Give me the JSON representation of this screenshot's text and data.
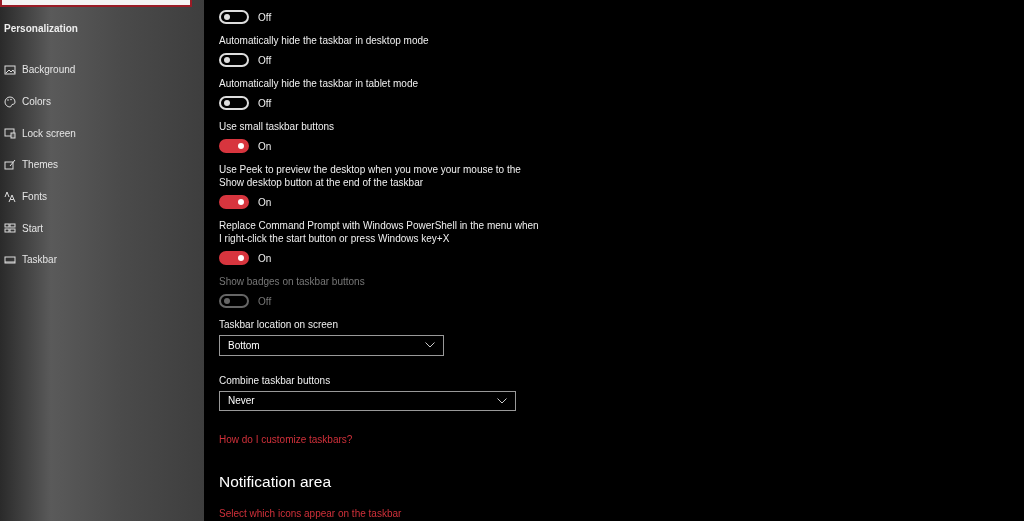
{
  "sidebar": {
    "heading": "Personalization",
    "items": [
      {
        "label": "Background"
      },
      {
        "label": "Colors"
      },
      {
        "label": "Lock screen"
      },
      {
        "label": "Themes"
      },
      {
        "label": "Fonts"
      },
      {
        "label": "Start"
      },
      {
        "label": "Taskbar"
      }
    ]
  },
  "settings": [
    {
      "kind": "toggle",
      "on": false,
      "disabled": false,
      "state": "Off"
    },
    {
      "kind": "toggle",
      "label": "Automatically hide the taskbar in desktop mode",
      "on": false,
      "disabled": false,
      "state": "Off"
    },
    {
      "kind": "toggle",
      "label": "Automatically hide the taskbar in tablet mode",
      "on": false,
      "disabled": false,
      "state": "Off"
    },
    {
      "kind": "toggle",
      "label": "Use small taskbar buttons",
      "on": true,
      "disabled": false,
      "state": "On"
    },
    {
      "kind": "toggle",
      "label": "Use Peek to preview the desktop when you move your mouse to the Show desktop button at the end of the taskbar",
      "on": true,
      "disabled": false,
      "state": "On"
    },
    {
      "kind": "toggle",
      "label": "Replace Command Prompt with Windows PowerShell in the menu when I right-click the start button or press Windows key+X",
      "on": true,
      "disabled": false,
      "state": "On"
    },
    {
      "kind": "toggle",
      "label": "Show badges on taskbar buttons",
      "on": false,
      "disabled": true,
      "state": "Off"
    },
    {
      "kind": "dropdown",
      "label": "Taskbar location on screen",
      "value": "Bottom",
      "wide": false
    },
    {
      "kind": "dropdown",
      "label": "Combine taskbar buttons",
      "value": "Never",
      "wide": true
    },
    {
      "kind": "link",
      "text": "How do I customize taskbars?"
    },
    {
      "kind": "heading",
      "text": "Notification area"
    },
    {
      "kind": "link",
      "text": "Select which icons appear on the taskbar"
    }
  ]
}
